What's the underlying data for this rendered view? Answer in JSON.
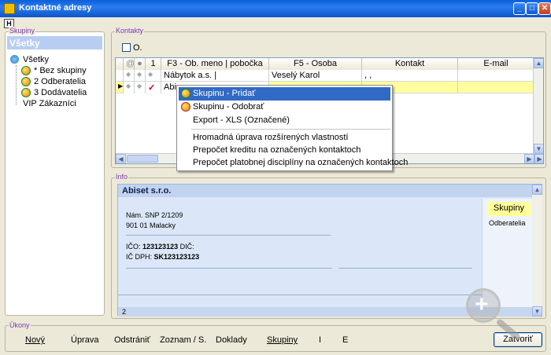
{
  "window": {
    "title": "Kontaktné adresy"
  },
  "toolbar": {
    "h_label": "H"
  },
  "groups": {
    "legend": "Skupiny",
    "header": "Všetky",
    "root": "Všetky",
    "items": [
      "* Bez skupiny",
      "2 Odberatelia",
      "3 Dodávatelia",
      "VIP Zákazníci"
    ]
  },
  "contacts": {
    "legend": "Kontakty",
    "checkbox_label": "O.",
    "columns": [
      "",
      "",
      "1",
      "F3 - Ob. meno | pobočka",
      "F5 - Osoba",
      "Kontakt",
      "E-mail"
    ],
    "rows": [
      {
        "name": "Nábytok a.s. |",
        "person": "Veselý Karol",
        "contact": ", ,",
        "email": ""
      },
      {
        "name": "Abise",
        "person": "",
        "contact": "",
        "email": ""
      }
    ]
  },
  "context_menu": {
    "items": [
      "Skupinu - Pridať",
      "Skupinu - Odobrať",
      "Export - XLS (Označené)",
      "Hromadná úprava rozšírených vlastností",
      "Prepočet kreditu na označených kontaktoch",
      "Prepočet platobnej disciplíny na označených kontaktoch"
    ]
  },
  "info": {
    "legend": "Info",
    "company": "Abiset s.r.o.",
    "address1": "Nám. SNP 2/1209",
    "address2": "901 01 Malacky",
    "ico_label": "IČO:",
    "ico": "123123123",
    "dic_label": "DIČ:",
    "icdph_label": "IČ DPH:",
    "icdph": "SK123123123",
    "group_badge": "Skupiny",
    "group_value": "Odberatelia",
    "count": "2"
  },
  "actions": {
    "legend": "Úkony",
    "new": "Nový",
    "edit": "Úprava",
    "delete": "Odstrániť",
    "list": "Zoznam / S.",
    "docs": "Doklady",
    "groups": "Skupiny",
    "i": "I",
    "e": "E",
    "close": "Zatvoriť"
  },
  "colors": {
    "selected_row": "#ffffa0",
    "menu_highlight": "#316ac5",
    "legend_text": "#7a3ab0"
  }
}
